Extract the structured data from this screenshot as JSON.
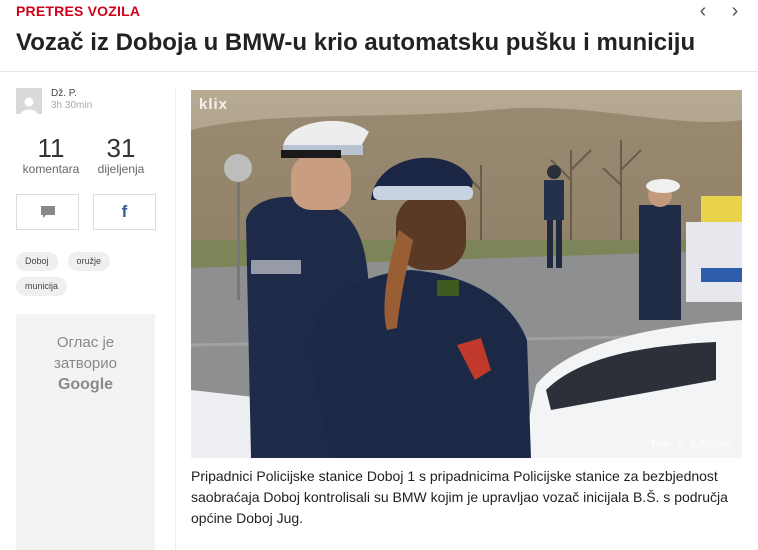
{
  "header": {
    "category": "PRETRES VOZILA",
    "title": "Vozač iz Doboja u BMW-u krio automatsku pušku i municiju",
    "nav_prev": "‹",
    "nav_next": "›"
  },
  "author": {
    "name": "Dž. P.",
    "time": "3h 30min"
  },
  "stats": {
    "comments_count": "11",
    "comments_label": "komentara",
    "shares_count": "31",
    "shares_label": "dijeljenja"
  },
  "share": {
    "facebook_glyph": "f"
  },
  "tags": [
    "Doboj",
    "oružje",
    "municija"
  ],
  "ad": {
    "line1": "Оглас је",
    "line2": "затворио",
    "brand": "Google"
  },
  "photo": {
    "watermark": "klix",
    "credit": "Foto: D. S./Klix.ba"
  },
  "caption": "Pripadnici Policijske stanice Doboj 1 s pripadnicima Policijske stanice za bezbjednost saobraćaja Doboj kontrolisali su BMW kojim je upravljao vozač inicijala B.Š. s područja općine Doboj Jug.",
  "colors": {
    "accent": "#d0021b",
    "facebook": "#3b5998"
  }
}
